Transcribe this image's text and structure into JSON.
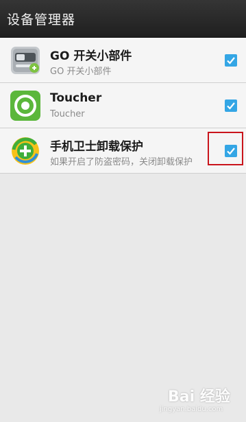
{
  "header": {
    "title": "设备管理器"
  },
  "admins": [
    {
      "name": "GO 开关小部件",
      "description": "GO 开关小部件",
      "icon": "go-switch-widget-icon",
      "checked": true
    },
    {
      "name": "Toucher",
      "description": "Toucher",
      "icon": "toucher-icon",
      "checked": true
    },
    {
      "name": "手机卫士卸载保护",
      "description": "如果开启了防盗密码，关闭卸载保护",
      "icon": "360-guard-icon",
      "checked": true
    }
  ],
  "watermark": {
    "text": "Bai 经验",
    "url": "jingyan.baidu.com"
  },
  "colors": {
    "accent": "#34a6e5",
    "titlebar": "#2a2a2a",
    "highlight": "#c9141b"
  }
}
